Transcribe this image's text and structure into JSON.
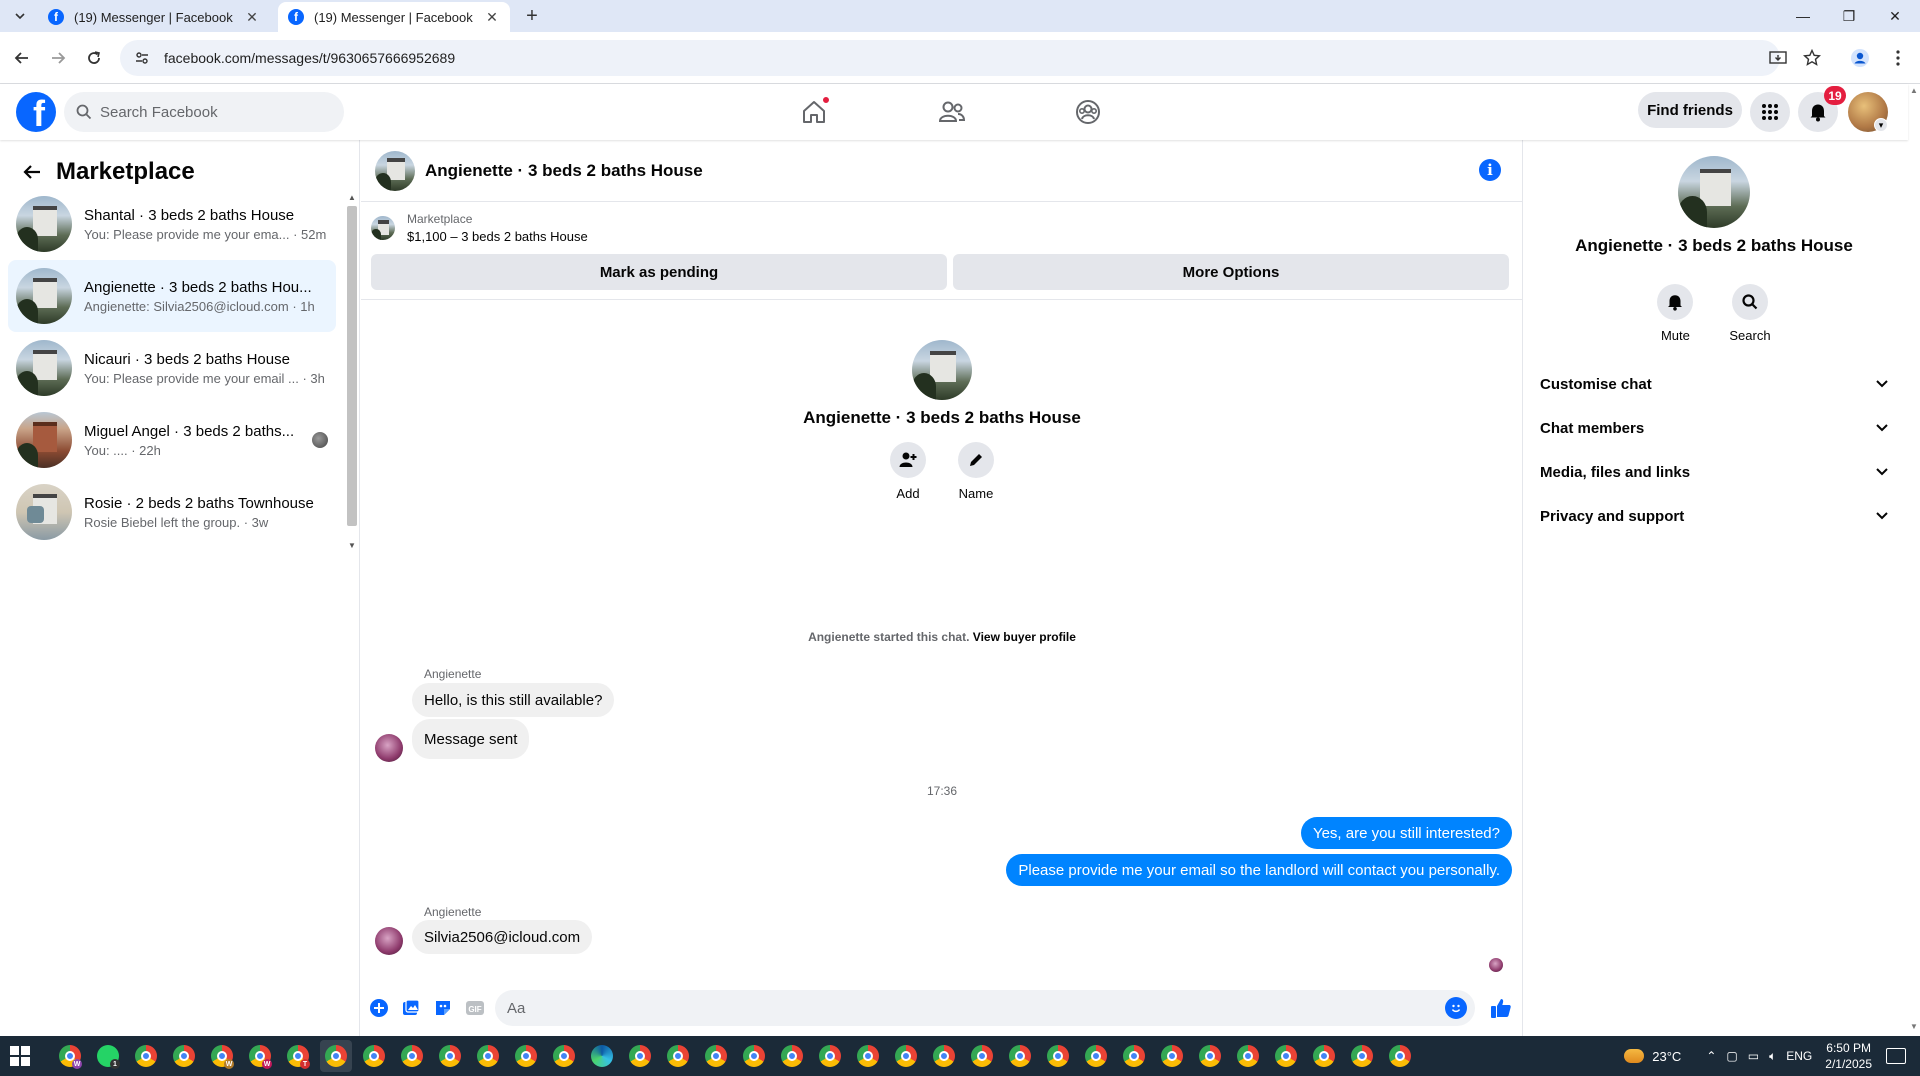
{
  "browser": {
    "tabs": [
      {
        "title": "(19) Messenger | Facebook",
        "active": false
      },
      {
        "title": "(19) Messenger | Facebook",
        "active": true
      }
    ],
    "url": "facebook.com/messages/t/9630657666952689"
  },
  "header": {
    "search_placeholder": "Search Facebook",
    "find_friends": "Find friends",
    "notification_count": "19"
  },
  "sidebar": {
    "title": "Marketplace",
    "conversations": [
      {
        "name": "Shantal · 3 beds 2 baths House",
        "preview": "You: Please provide me your ema... · 52m",
        "thumb": "house"
      },
      {
        "name": "Angienette · 3 beds 2 baths Hou...",
        "preview": "Angienette: Silvia2506@icloud.com · 1h",
        "thumb": "house",
        "selected": true
      },
      {
        "name": "Nicauri · 3 beds 2 baths House",
        "preview": "You: Please provide me your email ... · 3h",
        "thumb": "house"
      },
      {
        "name": "Miguel Angel · 3 beds 2 baths...",
        "preview": "You: .... · 22h",
        "thumb": "brick"
      },
      {
        "name": "Rosie · 2 beds 2 baths Townhouse",
        "preview": "Rosie Biebel left the group. · 3w",
        "thumb": "interior"
      }
    ]
  },
  "chat": {
    "title": "Angienette · 3 beds 2 baths House",
    "listing_source": "Marketplace",
    "listing_price": "$1,100 – 3 beds 2 baths House",
    "mark_pending": "Mark as pending",
    "more_options": "More Options",
    "intro_name": "Angienette · 3 beds 2 baths House",
    "intro_add": "Add",
    "intro_name_label": "Name",
    "started_text": "Angienette started this chat.",
    "view_buyer": "View buyer profile",
    "messages": {
      "sender1": "Angienette",
      "m1": "Hello, is this still available?",
      "m2": "Message sent",
      "time": "17:36",
      "m3": "Yes, are you still interested?",
      "m4": "Please provide me your email so the landlord will contact you personally.",
      "sender2": "Angienette",
      "m5": "Silvia2506@icloud.com"
    },
    "composer_placeholder": "Aa"
  },
  "right_panel": {
    "name": "Angienette · 3 beds 2 baths House",
    "mute": "Mute",
    "search": "Search",
    "sections": [
      "Customise chat",
      "Chat members",
      "Media, files and links",
      "Privacy and support"
    ]
  },
  "taskbar": {
    "temperature": "23°C",
    "language": "ENG",
    "time": "6:50 PM",
    "date": "2/1/2025"
  },
  "colors": {
    "brand": "#0866ff",
    "outgoing_bubble": "#0084ff",
    "badge": "#e41e3f"
  }
}
